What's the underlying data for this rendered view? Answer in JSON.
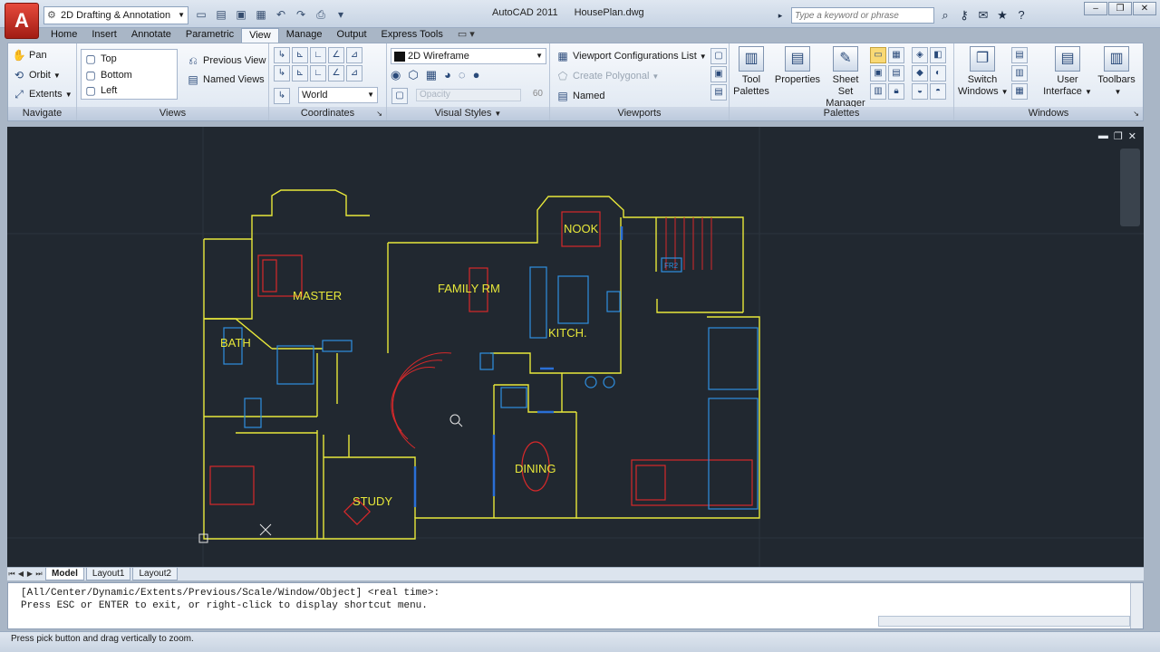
{
  "app": {
    "logo_letter": "A",
    "title": "AutoCAD 2011",
    "filename": "HousePlan.dwg"
  },
  "workspace": {
    "value": "2D Drafting & Annotation"
  },
  "search": {
    "placeholder": "Type a keyword or phrase"
  },
  "tabs": [
    {
      "label": "Home"
    },
    {
      "label": "Insert"
    },
    {
      "label": "Annotate"
    },
    {
      "label": "Parametric"
    },
    {
      "label": "View"
    },
    {
      "label": "Manage"
    },
    {
      "label": "Output"
    },
    {
      "label": "Express Tools"
    }
  ],
  "active_tab": "View",
  "ribbon": {
    "navigate": {
      "title": "Navigate",
      "pan": "Pan",
      "orbit": "Orbit",
      "extents": "Extents"
    },
    "views": {
      "title": "Views",
      "list": [
        "Top",
        "Bottom",
        "Left"
      ],
      "previous": "Previous View",
      "named": "Named Views"
    },
    "coordinates": {
      "title": "Coordinates",
      "ucs": "World"
    },
    "visual_styles": {
      "title": "Visual Styles",
      "style": "2D Wireframe",
      "opacity_label": "Opacity",
      "opacity_value": "60"
    },
    "viewports": {
      "title": "Viewports",
      "config": "Viewport Configurations List",
      "polygonal": "Create Polygonal",
      "named": "Named"
    },
    "palettes": {
      "title": "Palettes",
      "tool_palettes_1": "Tool",
      "tool_palettes_2": "Palettes",
      "properties": "Properties",
      "sheetset_1": "Sheet Set",
      "sheetset_2": "Manager"
    },
    "windows": {
      "title": "Windows",
      "switch_1": "Switch",
      "switch_2": "Windows",
      "ui_1": "User",
      "ui_2": "Interface",
      "toolbars": "Toolbars"
    }
  },
  "drawing": {
    "rooms": [
      "MASTER",
      "FAMILY RM",
      "NOOK",
      "KITCH.",
      "BATH",
      "STUDY",
      "DINING",
      "FR2"
    ],
    "colors": {
      "walls": "#e8e83a",
      "furniture": "#d8282a",
      "fixtures": "#2f8fe0",
      "doors": "#2a6fd6",
      "background": "#212830"
    }
  },
  "layout_tabs": [
    "Model",
    "Layout1",
    "Layout2"
  ],
  "command": {
    "line1": "[All/Center/Dynamic/Extents/Previous/Scale/Window/Object] <real time>:",
    "line2": "Press ESC or ENTER to exit, or right-click to display shortcut menu."
  },
  "status": {
    "text": "Press pick button and drag vertically to zoom."
  }
}
